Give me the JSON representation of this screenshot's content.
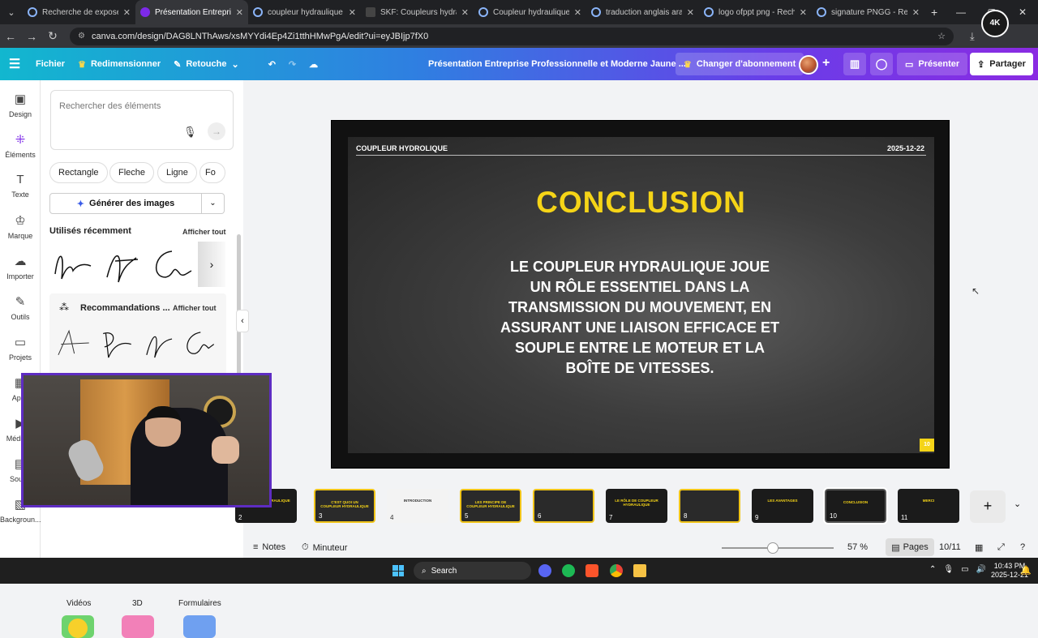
{
  "browser": {
    "tabs": [
      {
        "title": "Recherche de expose p",
        "icon": "chrome-globe-icon",
        "active": false
      },
      {
        "title": "Présentation Entreprise",
        "icon": "canva-icon",
        "active": true
      },
      {
        "title": "coupleur hydraulique ex",
        "icon": "google-icon",
        "active": false
      },
      {
        "title": "SKF: Coupleurs hydrauli",
        "icon": "skf-icon",
        "active": false
      },
      {
        "title": "Coupleur hydraulique d",
        "icon": "globe-icon",
        "active": false
      },
      {
        "title": "traduction anglais arab",
        "icon": "google-icon",
        "active": false
      },
      {
        "title": "logo ofppt png - Reche",
        "icon": "google-icon",
        "active": false
      },
      {
        "title": "signature PNGG - Reche",
        "icon": "google-icon",
        "active": false
      }
    ],
    "url": "canva.com/design/DAG8LNThAws/xsMYYdi4Ep4Zi1tthHMwPgA/edit?ui=eyJBIjp7fX0",
    "profile_badge": "4K"
  },
  "header": {
    "file": "Fichier",
    "resize": "Redimensionner",
    "retouch": "Retouche",
    "doc_title": "Présentation Entreprise Professionnelle et Moderne Jaune ...",
    "upgrade": "Changer d'abonnement",
    "present": "Présenter",
    "share": "Partager"
  },
  "rail": [
    {
      "label": "Design",
      "icon": "layout-icon"
    },
    {
      "label": "Éléments",
      "icon": "elements-icon",
      "selected": true
    },
    {
      "label": "Texte",
      "icon": "text-icon"
    },
    {
      "label": "Marque",
      "icon": "brand-icon"
    },
    {
      "label": "Importer",
      "icon": "upload-icon"
    },
    {
      "label": "Outils",
      "icon": "tools-icon"
    },
    {
      "label": "Projets",
      "icon": "folder-icon"
    },
    {
      "label": "Apps",
      "icon": "apps-icon"
    },
    {
      "label": "Média m",
      "icon": "media-icon"
    },
    {
      "label": "Sous-t",
      "icon": "subtitles-icon"
    },
    {
      "label": "Backgroun...",
      "icon": "background-icon"
    }
  ],
  "panel": {
    "search_placeholder": "Rechercher des éléments",
    "chips": [
      "Rectangle",
      "Fleche",
      "Ligne",
      "Fo"
    ],
    "generate": "Générer des images",
    "recent_title": "Utilisés récemment",
    "recent_all": "Afficher tout",
    "reco_title": "Recommandations ...",
    "reco_all": "Afficher tout",
    "categories": [
      "Vidéos",
      "3D",
      "Formulaires"
    ]
  },
  "slide": {
    "header_left": "COUPLEUR HYDROLIQUE",
    "header_right": "2025-12-22",
    "title": "CONCLUSION",
    "body": "LE COUPLEUR HYDRAULIQUE JOUE UN RÔLE ESSENTIEL DANS LA TRANSMISSION DU MOUVEMENT, EN ASSURANT UNE LIAISON EFFICACE ET SOUPLE ENTRE LE MOTEUR ET LA BOÎTE DE VITESSES.",
    "page_number": "10",
    "accent_color": "#f5d417"
  },
  "filmstrip": [
    {
      "num": "2",
      "title": "COUPLEUR HYDRAULIQUE",
      "style": "dark"
    },
    {
      "num": "3",
      "title": "C'EST QUOI UN COUPLEUR HYDRAULIQUE",
      "style": "yellow"
    },
    {
      "num": "4",
      "title": "INTRODUCTION",
      "style": "light"
    },
    {
      "num": "5",
      "title": "LES PRINCIPE DE COUPLEUR HYDRAULIQUE",
      "style": "yellow"
    },
    {
      "num": "6",
      "title": "",
      "style": "yellow"
    },
    {
      "num": "7",
      "title": "LE RÔLE DE COUPLEUR HYDRAULIQUE",
      "style": "dark"
    },
    {
      "num": "8",
      "title": "",
      "style": "yellow"
    },
    {
      "num": "9",
      "title": "LES AVANTAGES",
      "style": "dark"
    },
    {
      "num": "10",
      "title": "CONCLUSION",
      "style": "selected"
    },
    {
      "num": "11",
      "title": "MERCI",
      "style": "dark"
    }
  ],
  "bottombar": {
    "notes": "Notes",
    "timer": "Minuteur",
    "zoom": "57 %",
    "pages": "Pages",
    "page_count": "10/11"
  },
  "taskbar": {
    "search": "Search",
    "time": "10:43 PM",
    "date": "2025-12-21"
  }
}
